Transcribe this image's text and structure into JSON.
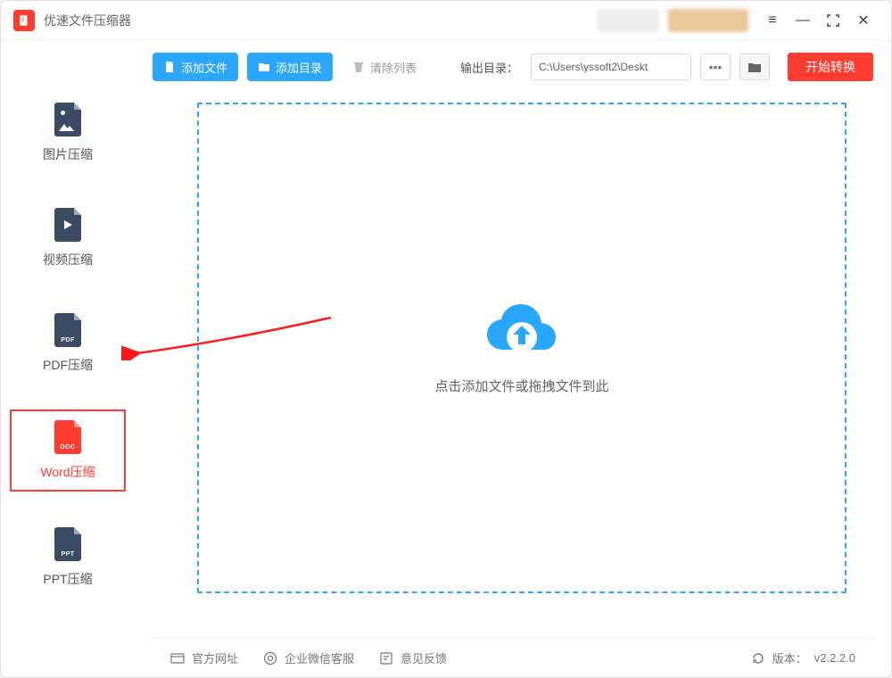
{
  "titlebar": {
    "title": "优速文件压缩器"
  },
  "sidebar": {
    "items": [
      {
        "label": "图片压缩",
        "tag": "",
        "icon": "image",
        "color": "#3b4b63"
      },
      {
        "label": "视频压缩",
        "tag": "",
        "icon": "video",
        "color": "#3b4b63"
      },
      {
        "label": "PDF压缩",
        "tag": "PDF",
        "icon": "pdf",
        "color": "#3b4b63"
      },
      {
        "label": "Word压缩",
        "tag": "DOC",
        "icon": "doc",
        "color": "#ff3c2f"
      },
      {
        "label": "PPT压缩",
        "tag": "PPT",
        "icon": "ppt",
        "color": "#3b4b63"
      }
    ],
    "active_index": 3
  },
  "toolbar": {
    "add_file": "添加文件",
    "add_folder": "添加目录",
    "clear_list": "清除列表",
    "output_dir_label": "输出目录：",
    "output_path": "C:\\Users\\yssoft2\\Deskt",
    "start": "开始转换"
  },
  "dropzone": {
    "text": "点击添加文件或拖拽文件到此"
  },
  "footer": {
    "website": "官方网址",
    "support": "企业微信客服",
    "feedback": "意见反馈",
    "version_label": "版本：",
    "version": "v2.2.2.0"
  }
}
